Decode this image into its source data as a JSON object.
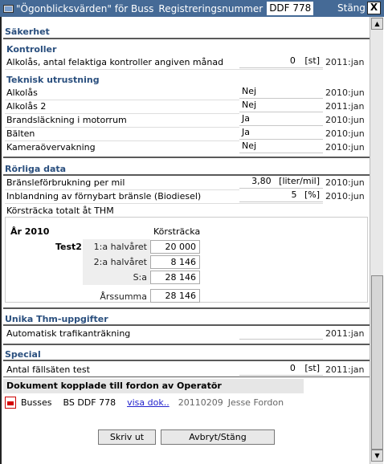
{
  "window": {
    "title": "\"Ögonblicksvärden\" för Buss",
    "reg_label": "Registreringsnummer",
    "reg_value": "DDF 778",
    "close_label": "Stäng",
    "close_x": "X"
  },
  "scrollbar": {
    "up": "▲",
    "down": "▼"
  },
  "sakerhet": {
    "title": "Säkerhet",
    "kontroller": {
      "title": "Kontroller",
      "rows": [
        {
          "label": "Alkolås, antal felaktiga kontroller angiven månad",
          "value": "0",
          "unit": "[st]",
          "date": "2011:jan"
        }
      ]
    },
    "teknisk": {
      "title": "Teknisk utrustning",
      "rows": [
        {
          "label": "Alkolås",
          "value": "Nej",
          "date": "2010:jun"
        },
        {
          "label": "Alkolås 2",
          "value": "Nej",
          "date": "2011:jan"
        },
        {
          "label": "Brandsläckning i motorrum",
          "value": "Ja",
          "date": "2010:jun"
        },
        {
          "label": "Bälten",
          "value": "Ja",
          "date": "2010:jun"
        },
        {
          "label": "Kameraövervakning",
          "value": "Nej",
          "date": "2010:jun"
        }
      ]
    }
  },
  "rorliga": {
    "title": "Rörliga data",
    "rows": [
      {
        "label": "Bränsleförbrukning per mil",
        "value": "3,80",
        "unit": "[liter/mil]",
        "date": "2010:jun"
      },
      {
        "label": "Inblandning av förnybart bränsle (Biodiesel)",
        "value": "5",
        "unit": "[%]",
        "date": "2010:jun"
      }
    ],
    "korstracka_label": "Körsträcka totalt åt THM",
    "korstracka": {
      "year": "År 2010",
      "col_header": "Körsträcka",
      "name": "Test2",
      "rows": [
        {
          "label": "1:a halvåret",
          "value": "20 000"
        },
        {
          "label": "2:a halvåret",
          "value": "8 146"
        },
        {
          "label": "S:a",
          "value": "28 146"
        }
      ],
      "arssumma_label": "Årssumma",
      "arssumma_value": "28 146"
    }
  },
  "unika": {
    "title": "Unika Thm-uppgifter",
    "rows": [
      {
        "label": "Automatisk trafikanträkning",
        "value": "",
        "date": "2011:jan"
      }
    ]
  },
  "special": {
    "title": "Special",
    "rows": [
      {
        "label": "Antal fällsäten test",
        "value": "0",
        "unit": "[st]",
        "date": "2011:jan"
      }
    ]
  },
  "documents": {
    "title": "Dokument kopplade till fordon av Operatör",
    "items": [
      {
        "name": "Busses",
        "reg": "BS DDF 778",
        "link": "visa dok..",
        "date": "20110209",
        "user": "Jesse Fordon"
      }
    ]
  },
  "buttons": {
    "print": "Skriv ut",
    "cancel": "Avbryt/Stäng"
  }
}
